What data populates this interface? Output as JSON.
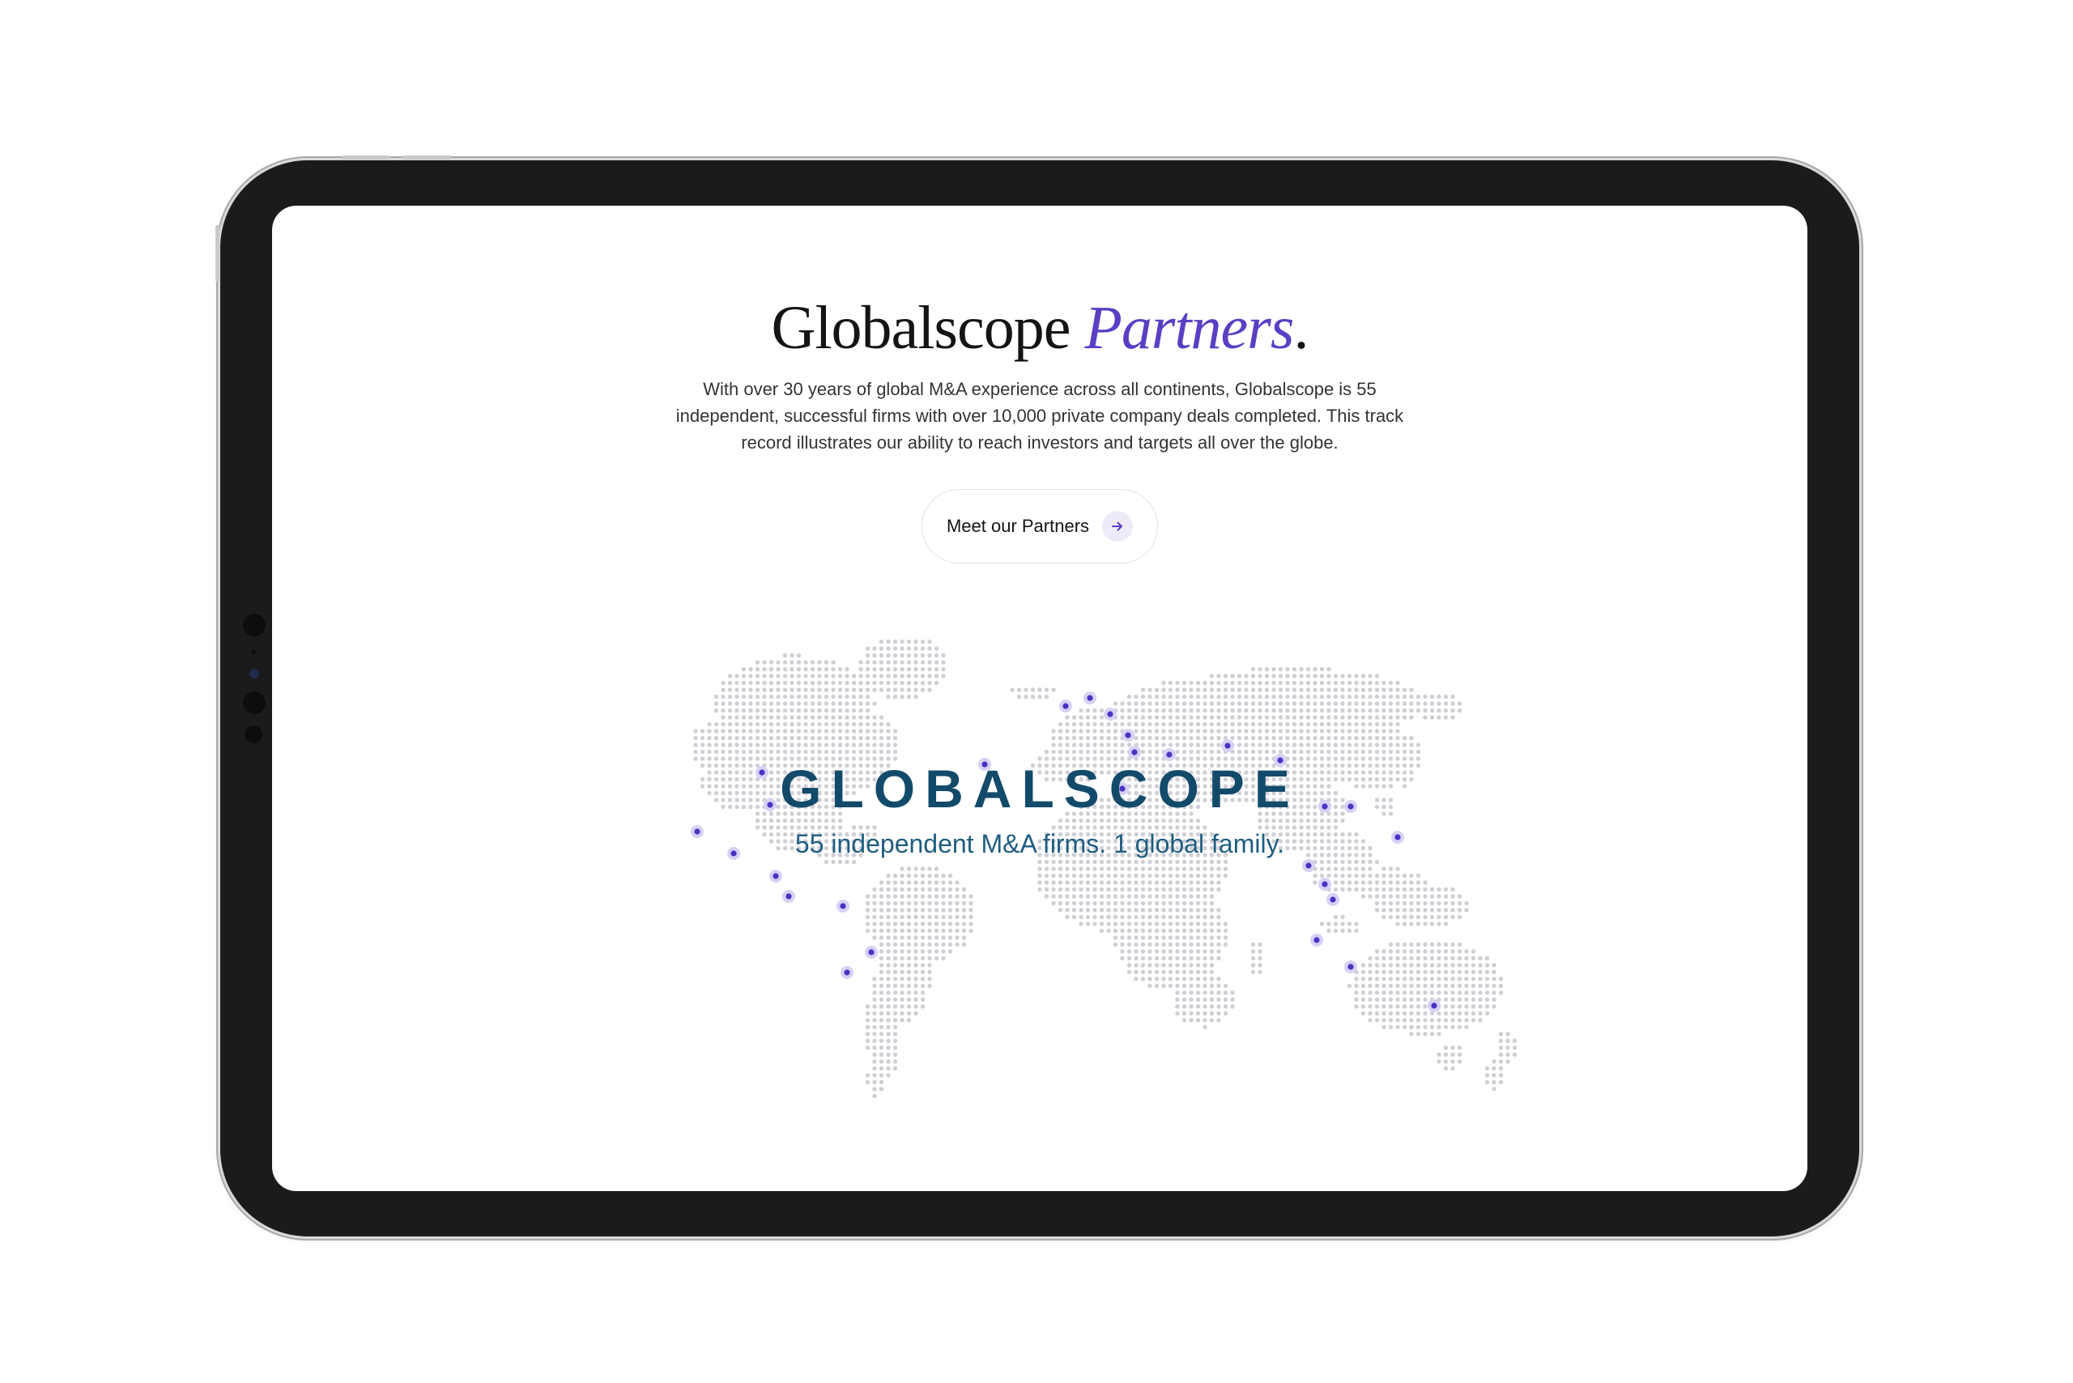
{
  "page": {
    "headline": "Globalscope",
    "headline_accent": "Partners",
    "headline_period": ".",
    "intro": "With over 30 years of global M&A experience across all continents, Globalscope is 55 independent, successful firms with over 10,000 private company deals completed. This track record illustrates our ability to reach investors and targets all over the globe.",
    "cta_label": "Meet our Partners",
    "cta_icon": "arrow-right-icon"
  },
  "map": {
    "brand_wordmark": "GLOBALSCOPE",
    "tagline": "55 independent M&A firms. 1 global family."
  },
  "colors": {
    "accent": "#5a3fc4",
    "brand": "#124a6a",
    "map_dot": "#cfcfd6",
    "partner_dot": "#4b32c3",
    "partner_halo": "#d8d0f5"
  }
}
